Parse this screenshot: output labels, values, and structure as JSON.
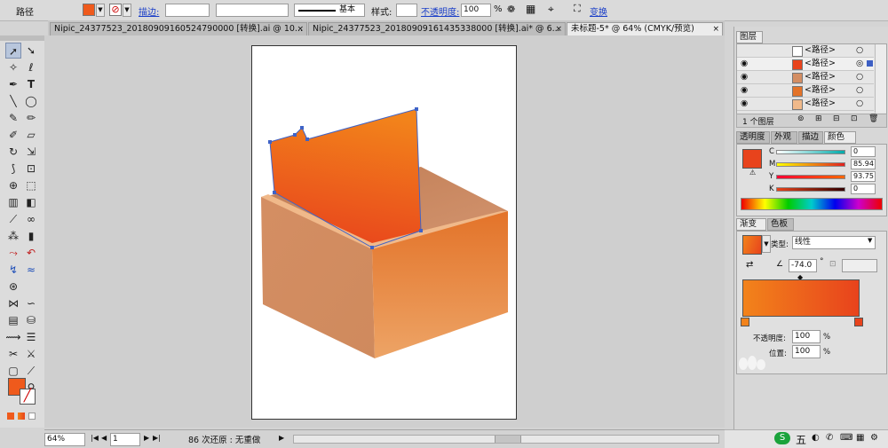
{
  "control_bar": {
    "selection_label": "路径",
    "stroke_label": "描边:",
    "stroke_profile": "基本",
    "style_label": "样式:",
    "opacity_label": "不透明度:",
    "opacity_value": "100",
    "opacity_unit": "%",
    "transform_label": "变换",
    "fill_color": "#ef5a1c"
  },
  "tabs": [
    {
      "label": "Nipic_24377523_20180909160524790000  [转换].ai @ 10..."
    },
    {
      "label": "Nipic_24377523_20180909161435338000  [转换].ai* @ 6..."
    },
    {
      "label": "未标题-5* @ 64% (CMYK/预览)"
    }
  ],
  "status_bar": {
    "zoom": "64%",
    "page": "1",
    "undo_text": "86 次还原 : 无重做"
  },
  "layers_panel": {
    "title": "图层",
    "rows": [
      {
        "label": "<路径>"
      },
      {
        "label": "<路径>"
      },
      {
        "label": "<路径>"
      },
      {
        "label": "<路径>"
      },
      {
        "label": "<路径>"
      }
    ],
    "footer": "1 个图层"
  },
  "color_panel": {
    "tabs": [
      "透明度",
      "外观",
      "描边",
      "颜色"
    ],
    "channels": [
      {
        "name": "C",
        "value": "0"
      },
      {
        "name": "M",
        "value": "85.94"
      },
      {
        "name": "Y",
        "value": "93.75"
      },
      {
        "name": "K",
        "value": "0"
      }
    ],
    "swatch": "#e8431c"
  },
  "gradient_panel": {
    "tabs": [
      "渐变",
      "色板"
    ],
    "type_label": "类型:",
    "type_value": "线性",
    "angle_value": "-74.0",
    "angle_unit": "°",
    "start_color": "#f2831b",
    "end_color": "#e8431c",
    "opacity_label": "不透明度:",
    "opacity_value": "100",
    "location_label": "位置:",
    "location_value": "100",
    "percent": "%"
  },
  "sysbar": {
    "ime": "五"
  }
}
